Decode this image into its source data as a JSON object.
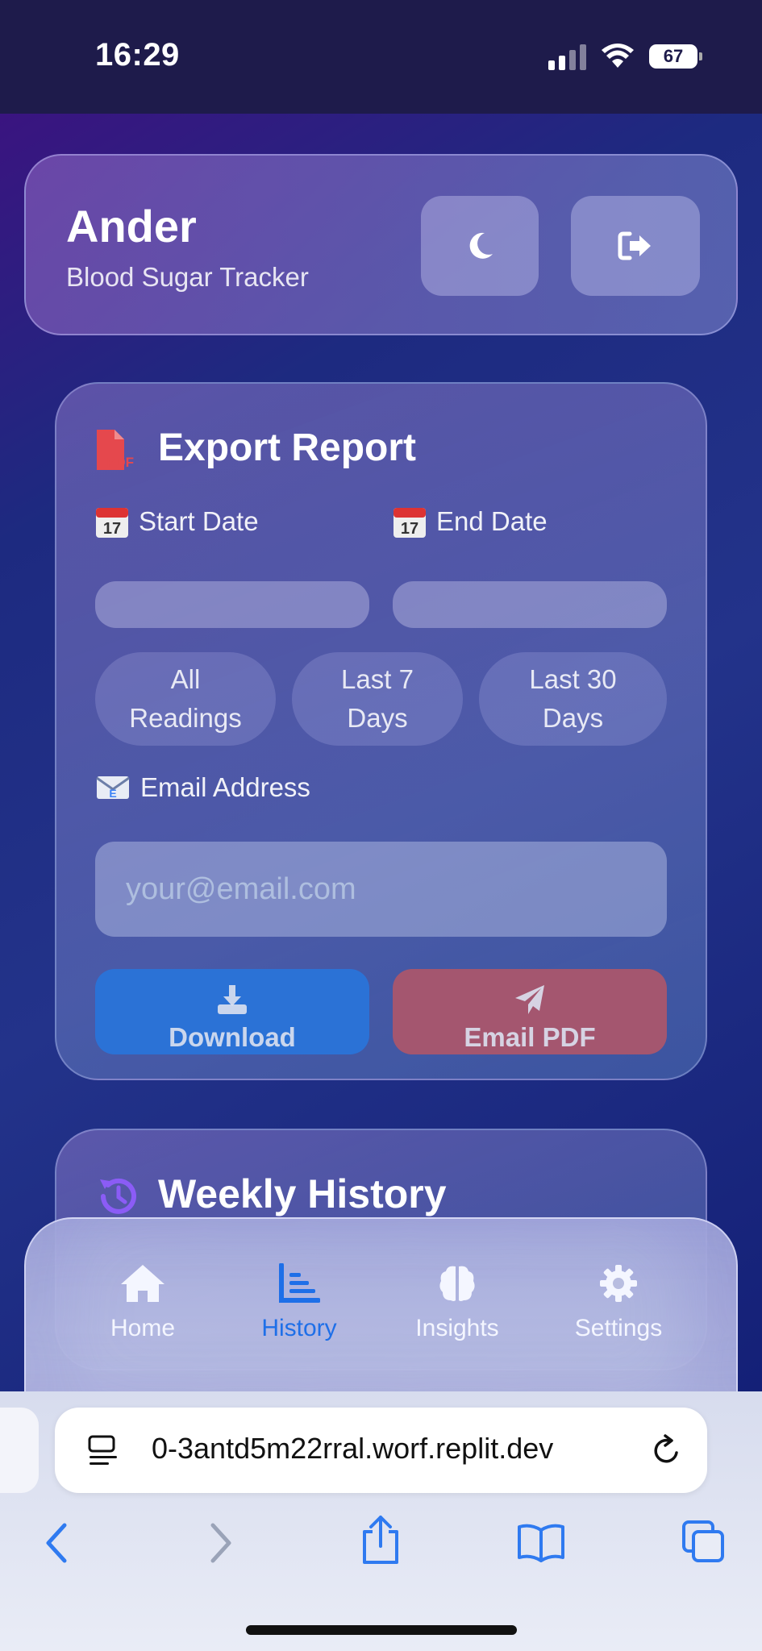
{
  "status_bar": {
    "time": "16:29",
    "battery": "67"
  },
  "header": {
    "user_name": "Ander",
    "subtitle": "Blood Sugar Tracker",
    "theme_button_icon": "moon-icon",
    "logout_button_icon": "sign-out-icon"
  },
  "export": {
    "title": "Export Report",
    "start_date_label": "Start Date",
    "end_date_label": "End Date",
    "start_date_value": "",
    "end_date_value": "",
    "range_options": [
      "All Readings",
      "Last 7 Days",
      "Last 30 Days"
    ],
    "email_label": "Email Address",
    "email_placeholder": "your@email.com",
    "email_value": "",
    "download_label": "Download",
    "email_pdf_label": "Email PDF"
  },
  "history": {
    "title": "Weekly History"
  },
  "nav": {
    "items": [
      {
        "label": "Home",
        "icon": "home-icon"
      },
      {
        "label": "History",
        "icon": "chart-icon"
      },
      {
        "label": "Insights",
        "icon": "brain-icon"
      },
      {
        "label": "Settings",
        "icon": "gear-icon"
      }
    ],
    "active": "History"
  },
  "browser": {
    "url": "0-3antd5m22rral.worf.replit.dev"
  },
  "colors": {
    "accent": "#1e6fe8",
    "download": "#2b72d6",
    "email_pdf": "#a4566f",
    "pdf_icon": "#e5484d",
    "history_icon": "#8b5cf6"
  }
}
